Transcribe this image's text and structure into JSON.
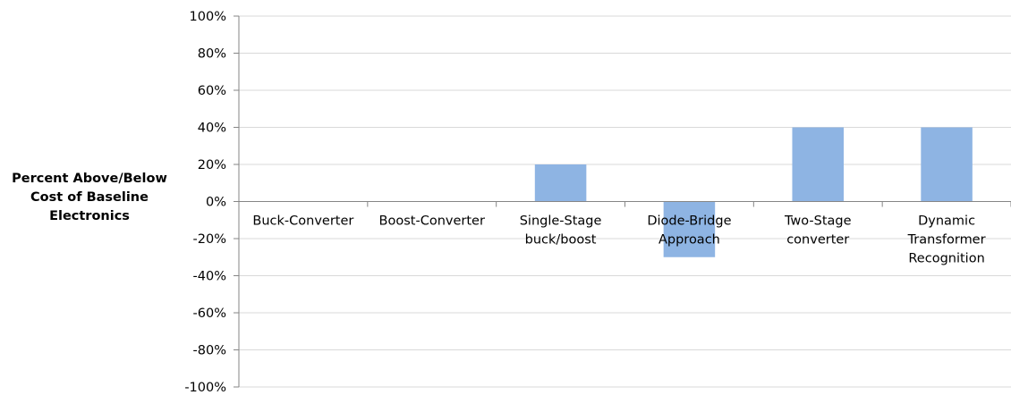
{
  "chart_data": {
    "type": "bar",
    "ylabel": "Percent Above/Below\nCost of Baseline\nElectronics",
    "categories": [
      "Buck-Converter",
      "Boost-Converter",
      "Single-Stage buck/boost",
      "Diode-Bridge Approach",
      "Two-Stage converter",
      "Dynamic Transformer Recognition"
    ],
    "category_lines": [
      [
        "Buck-Converter"
      ],
      [
        "Boost-Converter"
      ],
      [
        "Single-Stage",
        "buck/boost"
      ],
      [
        "Diode-Bridge",
        "Approach"
      ],
      [
        "Two-Stage",
        "converter"
      ],
      [
        "Dynamic",
        "Transformer",
        "Recognition"
      ]
    ],
    "values": [
      0,
      0,
      20,
      -30,
      40,
      40
    ],
    "ylim": [
      -100,
      100
    ],
    "yticks": [
      100,
      80,
      60,
      40,
      20,
      0,
      -20,
      -40,
      -60,
      -80,
      -100
    ],
    "ytick_labels": [
      "100%",
      "80%",
      "60%",
      "40%",
      "20%",
      "0%",
      "-20%",
      "-40%",
      "-60%",
      "-80%",
      "-100%"
    ],
    "grid": true,
    "bar_color": "#8EB4E3",
    "grid_color": "#D9D9D9",
    "axis_color": "#868686"
  }
}
